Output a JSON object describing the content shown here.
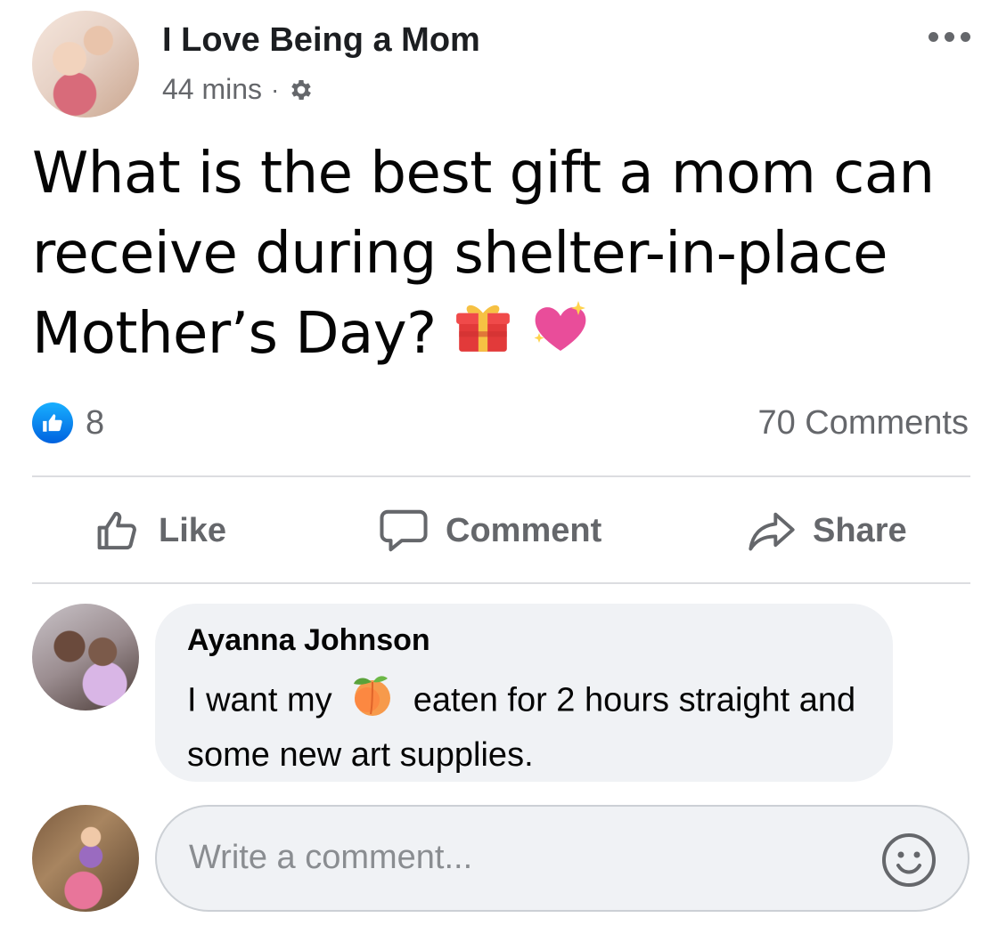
{
  "post": {
    "page_name": "I Love Being a Mom",
    "timestamp": "44 mins",
    "separator": "·",
    "text": "What is the best gift a mom can receive during shelter-in-place Mother’s Day?",
    "reactions_count": "8",
    "comments_count": "70 Comments"
  },
  "actions": {
    "like_label": "Like",
    "comment_label": "Comment",
    "share_label": "Share"
  },
  "comment": {
    "author": "Ayanna Johnson",
    "text_before": "I want my",
    "text_after": "eaten for 2 hours straight and some new art supplies."
  },
  "composer": {
    "placeholder": "Write a comment..."
  },
  "colors": {
    "like_blue": "#0062df",
    "secondary_text": "#65676b",
    "bubble_bg": "#f0f2f5"
  },
  "icons": [
    "more-options-icon",
    "settings-gear-icon",
    "like-reaction-icon",
    "thumbs-up-icon",
    "comment-icon",
    "share-icon",
    "gift-emoji",
    "sparkling-heart-emoji",
    "peach-emoji",
    "smiley-icon"
  ]
}
